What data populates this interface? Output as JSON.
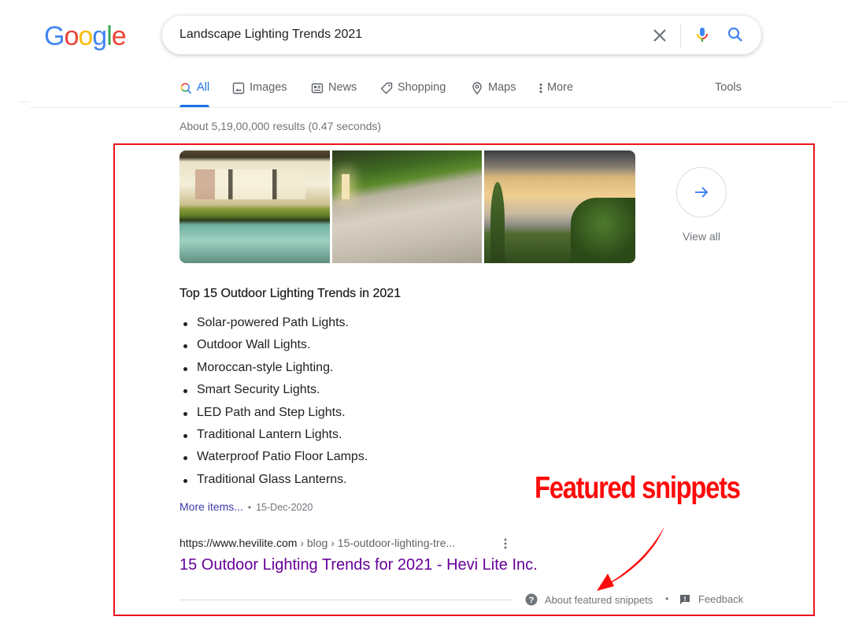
{
  "logo": {
    "letters": [
      "G",
      "o",
      "o",
      "g",
      "l",
      "e"
    ],
    "colors": [
      "#4285f4",
      "#ea4335",
      "#fbbc05",
      "#4285f4",
      "#34a853",
      "#ea4335"
    ]
  },
  "search": {
    "query": "Landscape Lighting Trends 2021",
    "clear_icon": "close-icon",
    "voice_icon": "microphone-icon",
    "search_icon": "search-icon"
  },
  "tabs": [
    {
      "label": "All",
      "icon": "search-icon",
      "active": true
    },
    {
      "label": "Images",
      "icon": "image-icon",
      "active": false
    },
    {
      "label": "News",
      "icon": "newspaper-icon",
      "active": false
    },
    {
      "label": "Shopping",
      "icon": "tag-icon",
      "active": false
    },
    {
      "label": "Maps",
      "icon": "map-pin-icon",
      "active": false
    },
    {
      "label": "More",
      "icon": "more-vertical-icon",
      "active": false
    }
  ],
  "tools_label": "Tools",
  "stats": "About 5,19,00,000 results (0.47 seconds)",
  "featured_snippet": {
    "images": [
      {
        "alt": "Illuminated house with pool at night"
      },
      {
        "alt": "Lit stone pathway with path lights"
      },
      {
        "alt": "Lit patio with staircase and garden"
      }
    ],
    "view_all_label": "View all",
    "title": "Top 15 Outdoor Lighting Trends in 2021",
    "items": [
      "Solar-powered Path Lights.",
      "Outdoor Wall Lights.",
      "Moroccan-style Lighting.",
      "Smart Security Lights.",
      "LED Path and Step Lights.",
      "Traditional Lantern Lights.",
      "Waterproof Patio Floor Lamps.",
      "Traditional Glass Lanterns."
    ],
    "more_items_label": "More items...",
    "separator": "•",
    "date": "15-Dec-2020",
    "cite_url": "https://www.hevilite.com",
    "cite_crumbs": " › blog › 15-outdoor-lighting-tre...",
    "result_title": "15 Outdoor Lighting Trends for 2021 - Hevi Lite Inc.",
    "about_label": "About featured snippets",
    "feedback_label": "Feedback"
  },
  "annotation": {
    "label": "Featured snippets",
    "color": "#ff0a0a"
  },
  "colors": {
    "accent_blue": "#1a73e8",
    "visited_link": "#660099",
    "highlight_border": "#e8141b"
  }
}
